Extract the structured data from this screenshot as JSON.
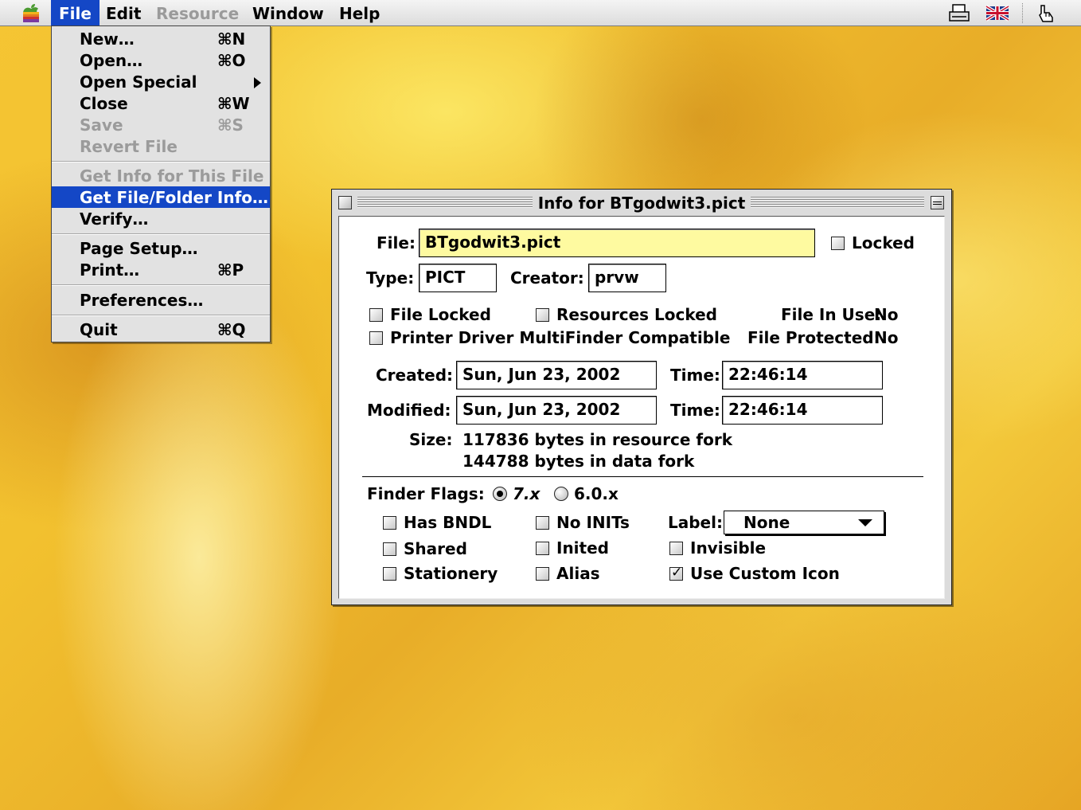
{
  "menubar": {
    "apple_icon": "apple-icon",
    "menus": [
      "File",
      "Edit",
      "Resource",
      "Window",
      "Help"
    ],
    "tray_icons": [
      "printer-icon",
      "uk-flag-icon",
      "help-balloon-icon"
    ]
  },
  "file_menu": {
    "items": [
      {
        "label": "New…",
        "shortcut": "⌘N",
        "enabled": true
      },
      {
        "label": "Open…",
        "shortcut": "⌘O",
        "enabled": true
      },
      {
        "label": "Open Special",
        "shortcut": "",
        "enabled": true,
        "submenu": true
      },
      {
        "label": "Close",
        "shortcut": "⌘W",
        "enabled": true
      },
      {
        "label": "Save",
        "shortcut": "⌘S",
        "enabled": false
      },
      {
        "label": "Revert File",
        "shortcut": "",
        "enabled": false
      },
      {
        "label": "Get Info for This File",
        "shortcut": "",
        "enabled": false
      },
      {
        "label": "Get File/Folder Info…",
        "shortcut": "",
        "enabled": true,
        "selected": true
      },
      {
        "label": "Verify…",
        "shortcut": "",
        "enabled": true
      },
      {
        "label": "Page Setup…",
        "shortcut": "",
        "enabled": true
      },
      {
        "label": "Print…",
        "shortcut": "⌘P",
        "enabled": true
      },
      {
        "label": "Preferences…",
        "shortcut": "",
        "enabled": true
      },
      {
        "label": "Quit",
        "shortcut": "⌘Q",
        "enabled": true
      }
    ]
  },
  "info_window": {
    "title": "Info for BTgodwit3.pict",
    "file_label": "File:",
    "file_value": "BTgodwit3.pict",
    "locked_label": "Locked",
    "type_label": "Type:",
    "type_value": "PICT",
    "creator_label": "Creator:",
    "creator_value": "prvw",
    "file_locked_label": "File Locked",
    "resources_locked_label": "Resources Locked",
    "file_in_use_label": "File In Use:",
    "file_in_use_value": "No",
    "printer_driver_label": "Printer Driver MultiFinder Compatible",
    "file_protected_label": "File Protected:",
    "file_protected_value": "No",
    "created_label": "Created:",
    "created_date": "Sun, Jun 23, 2002",
    "created_time_label": "Time:",
    "created_time": "22:46:14",
    "modified_label": "Modified:",
    "modified_date": "Sun, Jun 23, 2002",
    "modified_time_label": "Time:",
    "modified_time": "22:46:14",
    "size_label": "Size:",
    "size_resource": "117836 bytes in resource fork",
    "size_data": "144788 bytes in data fork",
    "finder_flags_label": "Finder Flags:",
    "flag_version_7": "7.x",
    "flag_version_6": "6.0.x",
    "has_bndl_label": "Has BNDL",
    "no_inits_label": "No INITs",
    "label_label": "Label:",
    "label_value": "None",
    "shared_label": "Shared",
    "inited_label": "Inited",
    "invisible_label": "Invisible",
    "stationery_label": "Stationery",
    "alias_label": "Alias",
    "use_custom_icon_label": "Use Custom Icon",
    "use_custom_icon_checked": true,
    "selected_version": "7.x",
    "accent_color": "#1447c6",
    "field_highlight_color": "#fefaa0"
  }
}
